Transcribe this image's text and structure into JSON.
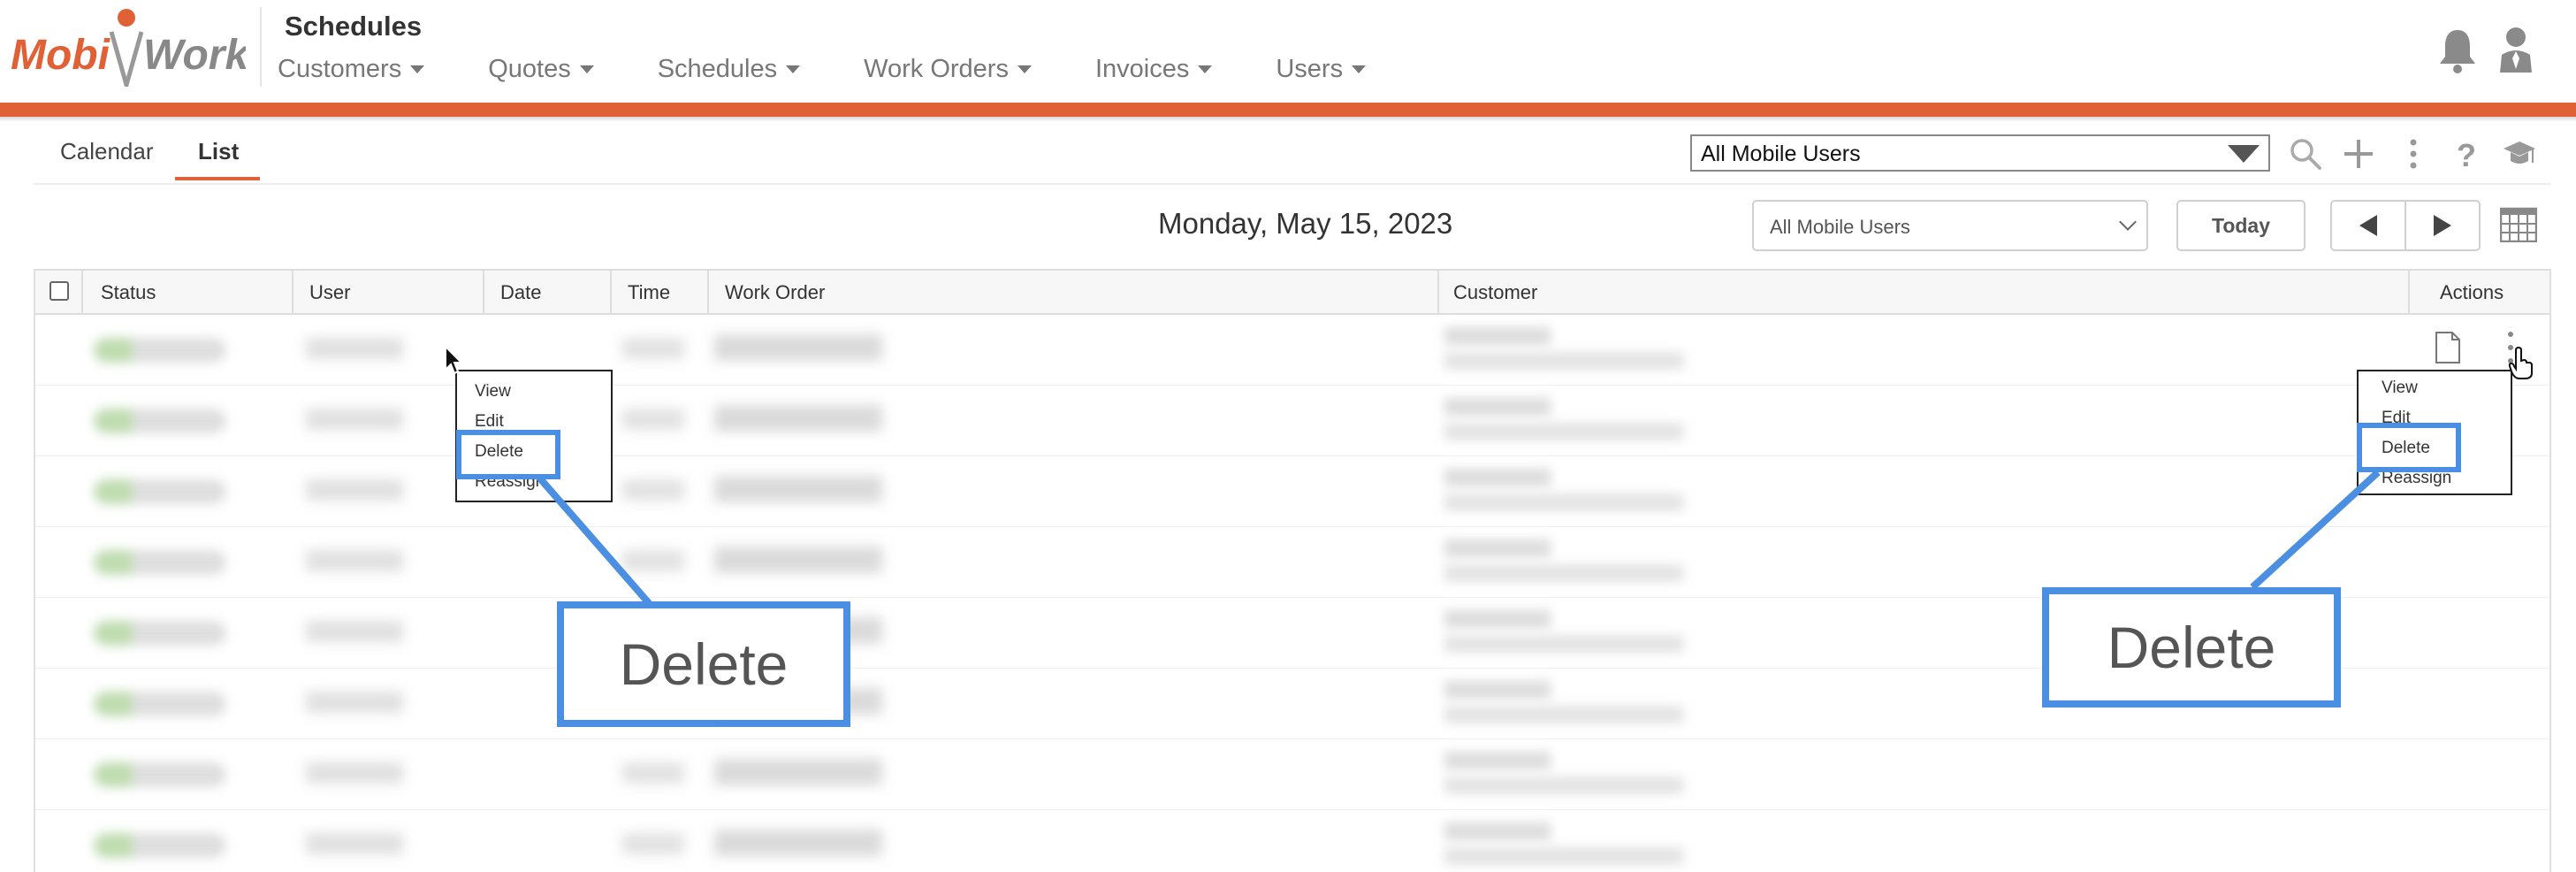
{
  "app": {
    "logo_text_left": "Mobi",
    "logo_text_right": "Work",
    "title": "Schedules"
  },
  "nav": [
    {
      "label": "Customers"
    },
    {
      "label": "Quotes"
    },
    {
      "label": "Schedules"
    },
    {
      "label": "Work Orders"
    },
    {
      "label": "Invoices"
    },
    {
      "label": "Users"
    }
  ],
  "tabs": [
    {
      "label": "Calendar",
      "active": false
    },
    {
      "label": "List",
      "active": true
    }
  ],
  "filters": {
    "top_select_value": "All Mobile Users",
    "second_select_value": "All Mobile Users"
  },
  "date_bar": {
    "date": "Monday, May 15, 2023",
    "today_label": "Today"
  },
  "table": {
    "columns": [
      "Status",
      "User",
      "Date",
      "Time",
      "Work Order",
      "Customer",
      "Actions"
    ]
  },
  "context_menu_left": {
    "items": [
      "View",
      "Edit",
      "Delete",
      "Reassign"
    ],
    "highlighted": "Delete"
  },
  "context_menu_right": {
    "items": [
      "View",
      "Edit",
      "Delete",
      "Reassign"
    ],
    "highlighted": "Delete"
  },
  "callouts": {
    "left_label": "Delete",
    "right_label": "Delete"
  },
  "colors": {
    "brand_orange": "#e16137",
    "highlight_blue": "#4a8fe2",
    "status_green": "#b4d6a3"
  },
  "icons": [
    "bell-icon",
    "user-icon",
    "search-icon",
    "plus-icon",
    "more-vertical-icon",
    "help-icon",
    "graduation-cap-icon",
    "calendar-grid-icon",
    "document-icon",
    "pointer-cursor-icon",
    "hand-cursor-icon"
  ]
}
